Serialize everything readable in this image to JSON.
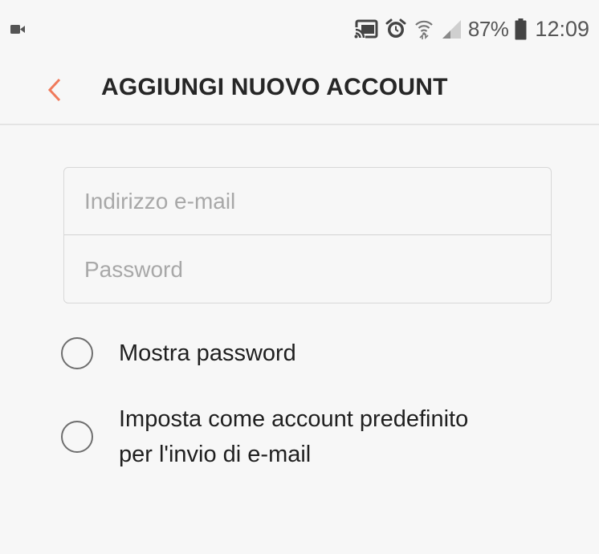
{
  "status_bar": {
    "battery_percent": "87%",
    "time": "12:09",
    "left_icon": "video-camera-icon",
    "right_icons": [
      "cast-icon",
      "alarm-icon",
      "wifi-icon",
      "signal-icon",
      "battery-icon"
    ]
  },
  "header": {
    "back_icon": "chevron-left-icon",
    "title": "AGGIUNGI NUOVO ACCOUNT"
  },
  "form": {
    "email": {
      "placeholder": "Indirizzo e-mail",
      "value": ""
    },
    "password": {
      "placeholder": "Password",
      "value": ""
    }
  },
  "options": {
    "show_password": {
      "label": "Mostra password",
      "checked": false
    },
    "default_account": {
      "label_line1": "Imposta come account predefinito",
      "label_line2": "per l'invio di e-mail",
      "checked": false
    }
  },
  "colors": {
    "accent": "#f07a5b",
    "background": "#f7f7f7"
  }
}
